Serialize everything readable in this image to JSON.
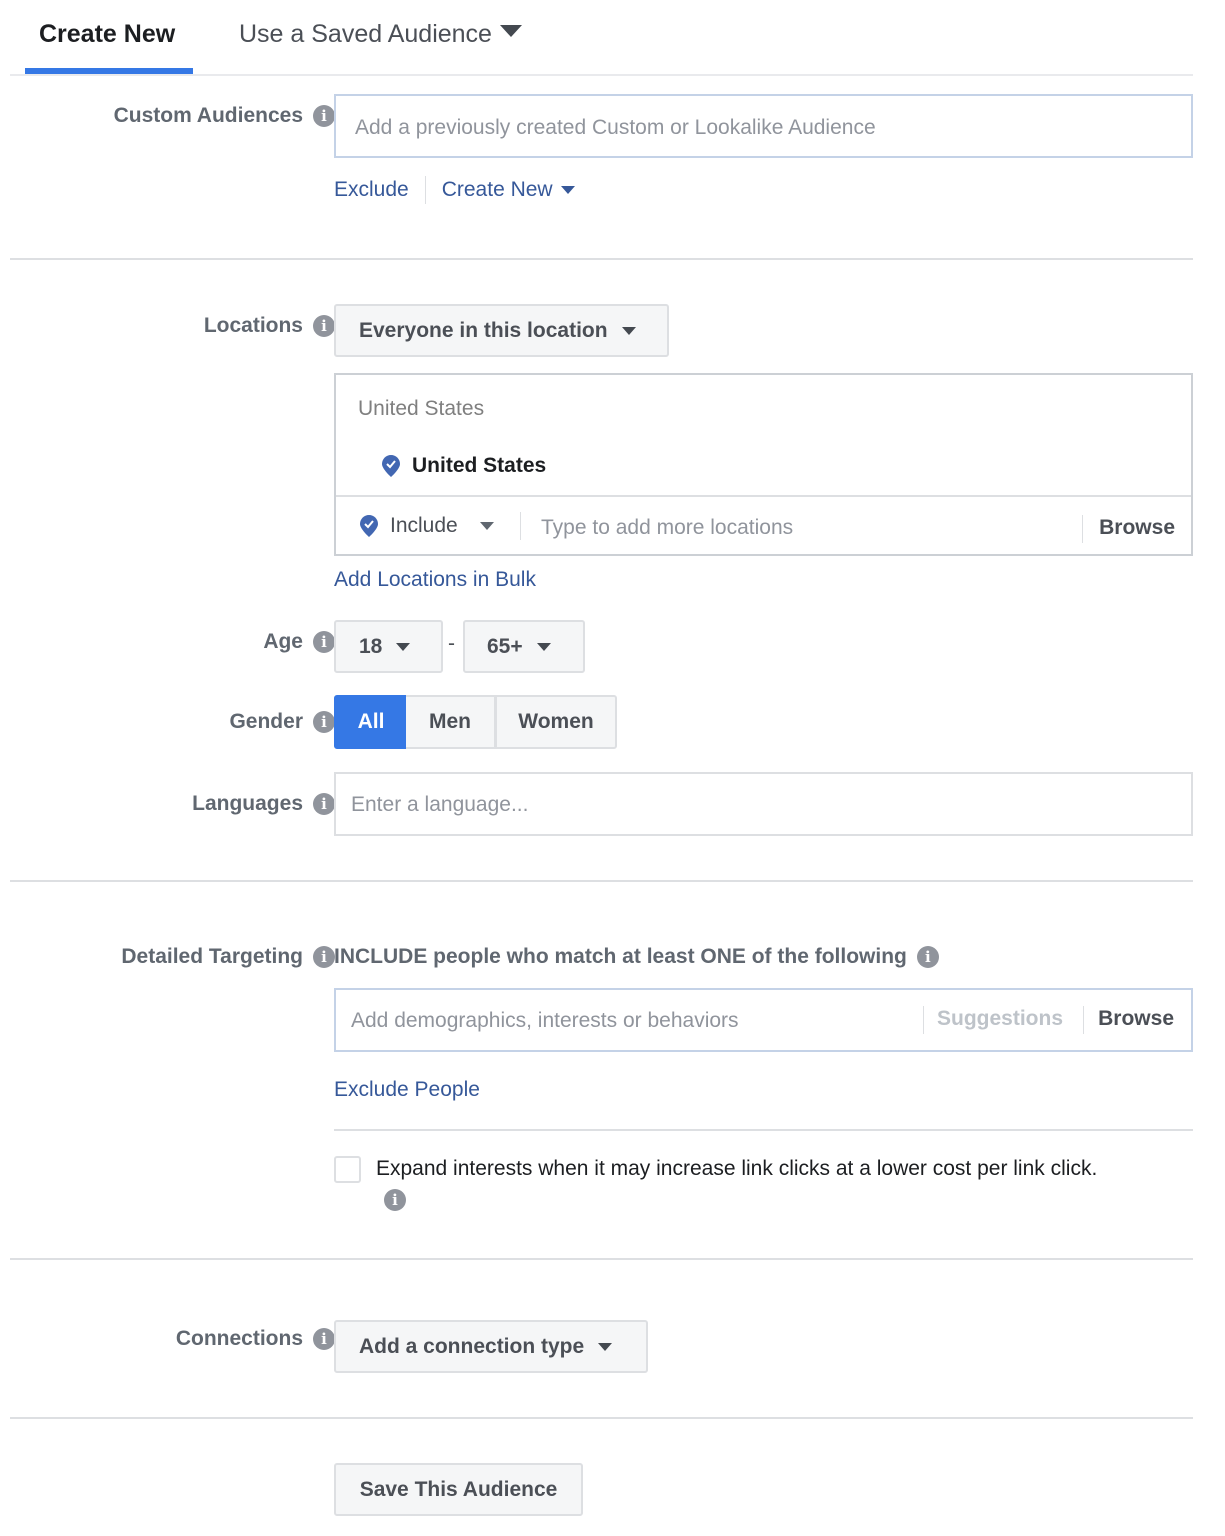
{
  "tabs": {
    "create_new": "Create New",
    "use_saved": "Use a Saved Audience"
  },
  "custom_audiences": {
    "label": "Custom Audiences",
    "placeholder": "Add a previously created Custom or Lookalike Audience",
    "exclude": "Exclude",
    "create_new": "Create New"
  },
  "locations": {
    "label": "Locations",
    "type_select": "Everyone in this location",
    "group_title": "United States",
    "selected_location": "United States",
    "include_select": "Include",
    "placeholder": "Type to add more locations",
    "browse": "Browse",
    "bulk_link": "Add Locations in Bulk"
  },
  "age": {
    "label": "Age",
    "min": "18",
    "separator": "-",
    "max": "65+"
  },
  "gender": {
    "label": "Gender",
    "options": [
      "All",
      "Men",
      "Women"
    ],
    "selected": "All"
  },
  "languages": {
    "label": "Languages",
    "placeholder": "Enter a language..."
  },
  "detailed_targeting": {
    "label": "Detailed Targeting",
    "heading": "INCLUDE people who match at least ONE of the following",
    "placeholder": "Add demographics, interests or behaviors",
    "suggestions": "Suggestions",
    "browse": "Browse",
    "exclude_link": "Exclude People",
    "expand_checkbox_label": "Expand interests when it may increase link clicks at a lower cost per link click.",
    "expand_checked": false
  },
  "connections": {
    "label": "Connections",
    "select": "Add a connection type"
  },
  "save_button": "Save This Audience",
  "colors": {
    "accent": "#3578e5",
    "link": "#365899",
    "pin": "#4267b2"
  }
}
